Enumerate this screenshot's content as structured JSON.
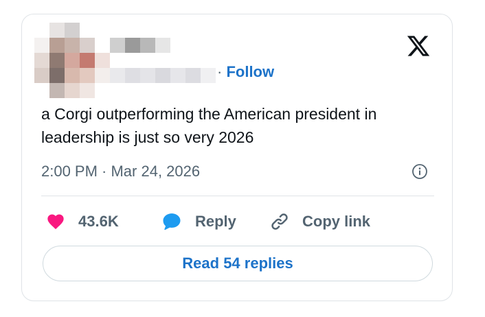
{
  "header": {
    "separator": "·",
    "follow_label": "Follow",
    "logo_icon": "x-logo-icon"
  },
  "tweet": {
    "text": "a Corgi outperforming the American president in leadership is just so very 2026",
    "timestamp": "2:00 PM · Mar 24, 2026",
    "info_icon": "info-icon"
  },
  "actions": {
    "like_count": "43.6K",
    "like_icon": "heart-icon",
    "reply_label": "Reply",
    "reply_icon": "speech-bubble-icon",
    "copy_label": "Copy link",
    "copy_icon": "link-icon"
  },
  "footer": {
    "read_replies_label": "Read 54 replies"
  },
  "colors": {
    "link_blue": "#1d73c9",
    "heart_pink": "#f91880",
    "bubble_blue": "#1d9bf0",
    "muted_text": "#536471",
    "main_text": "#0f1419",
    "border": "#dfe3e7"
  }
}
